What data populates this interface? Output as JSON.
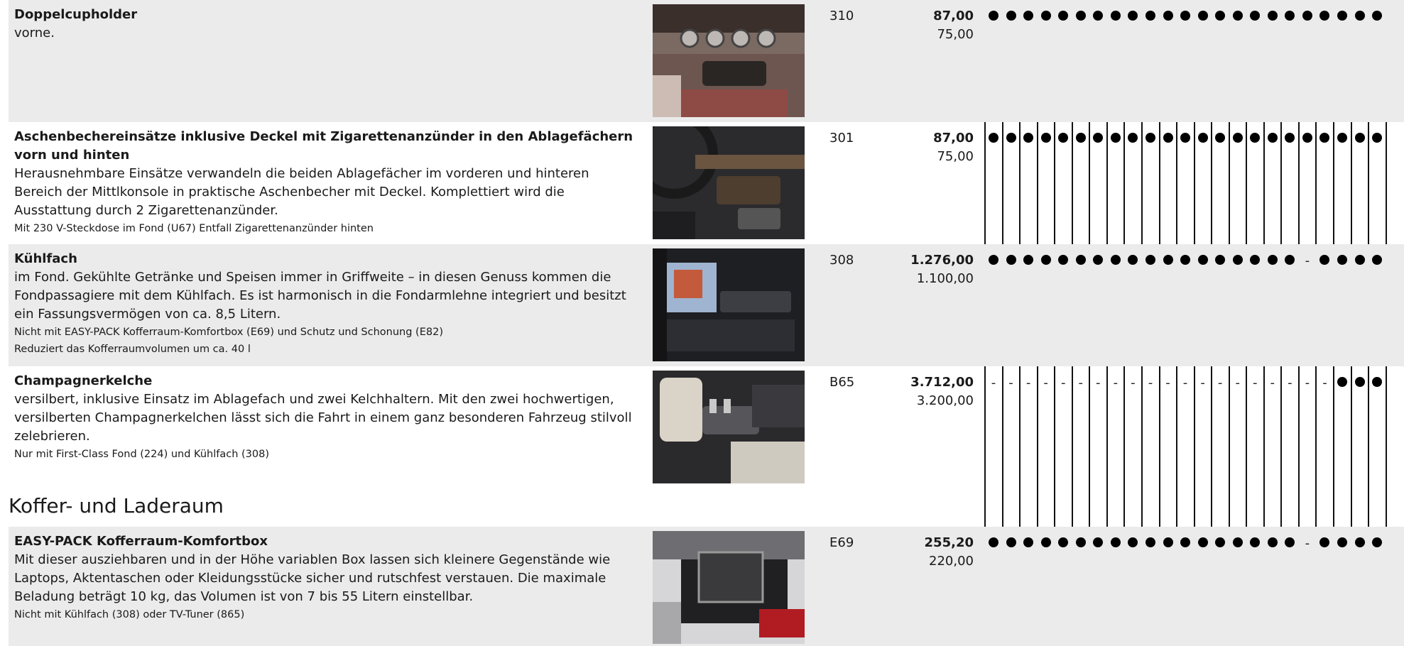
{
  "items": [
    {
      "title": "Doppelcupholder",
      "description": "vorne.",
      "notes": [],
      "code": "310",
      "price_gross": "87,00",
      "price_net": "75,00",
      "image": "car-interior-cupholder-photo",
      "marks": [
        "dot",
        "dot",
        "dot",
        "dot",
        "dot",
        "dot",
        "dot",
        "dot",
        "dot",
        "dot",
        "dot",
        "dot",
        "dot",
        "dot",
        "dot",
        "dot",
        "dot",
        "dot",
        "dot",
        "dot",
        "dot",
        "dot",
        "dot"
      ]
    },
    {
      "title": "Aschenbechereinsätze inklusive Deckel mit Zigarettenanzünder in den Ablagefächern vorn und hinten",
      "description": "Herausnehmbare Einsätze verwandeln die beiden Ablagefächer im vorderen und hinteren Bereich der Mittlkonsole in praktische Aschenbecher mit Deckel. Komplettiert wird die Ausstattung durch 2 Zigarettenanzünder.",
      "notes": [
        "Mit 230 V-Steckdose im Fond (U67) Entfall Zigarettenanzünder hinten"
      ],
      "code": "301",
      "price_gross": "87,00",
      "price_net": "75,00",
      "image": "car-center-console-photo",
      "marks": [
        "dot",
        "dot",
        "dot",
        "dot",
        "dot",
        "dot",
        "dot",
        "dot",
        "dot",
        "dot",
        "dot",
        "dot",
        "dot",
        "dot",
        "dot",
        "dot",
        "dot",
        "dot",
        "dot",
        "dot",
        "dot",
        "dot",
        "dot"
      ]
    },
    {
      "title": "Kühlfach",
      "description": "im Fond. Gekühlte Getränke und Speisen immer in Griffweite – in diesen Genuss kommen die Fondpassagiere mit dem Kühlfach. Es ist harmonisch in die Fondarmlehne integriert und besitzt ein Fassungsvermögen von ca. 8,5 Litern.",
      "notes": [
        "Nicht mit EASY-PACK Kofferraum-Komfortbox (E69) und Schutz und Schonung (E82)",
        "Reduziert das Kofferraumvolumen um ca. 40 l"
      ],
      "code": "308",
      "price_gross": "1.276,00",
      "price_net": "1.100,00",
      "image": "rear-cooling-box-photo",
      "marks": [
        "dot",
        "dot",
        "dot",
        "dot",
        "dot",
        "dot",
        "dot",
        "dot",
        "dot",
        "dot",
        "dot",
        "dot",
        "dot",
        "dot",
        "dot",
        "dot",
        "dot",
        "dot",
        "dash",
        "dot",
        "dot",
        "dot",
        "dot"
      ]
    },
    {
      "title": "Champagnerkelche",
      "description": "versilbert, inklusive Einsatz im Ablagefach und zwei Kelchhaltern. Mit den zwei hochwertigen, versilberten Champagnerkelchen lässt sich die Fahrt in einem ganz besonderen Fahrzeug stilvoll zelebrieren.",
      "notes": [
        "Nur mit First-Class Fond (224) und Kühlfach (308)"
      ],
      "code": "B65",
      "price_gross": "3.712,00",
      "price_net": "3.200,00",
      "image": "rear-seat-champagne-photo",
      "marks": [
        "dash",
        "dash",
        "dash",
        "dash",
        "dash",
        "dash",
        "dash",
        "dash",
        "dash",
        "dash",
        "dash",
        "dash",
        "dash",
        "dash",
        "dash",
        "dash",
        "dash",
        "dash",
        "dash",
        "dash",
        "dot",
        "dot",
        "dot"
      ]
    },
    {
      "title": "EASY-PACK Kofferraum-Komfortbox",
      "description": "Mit dieser ausziehbaren und in der Höhe variablen Box lassen sich kleinere Gegenstände wie Laptops, Aktentaschen oder Kleidungsstücke sicher und rutschfest verstauen. Die maximale Beladung beträgt 10 kg, das Volumen ist von 7 bis 55 Litern einstellbar.",
      "notes": [
        "Nicht mit Kühlfach (308) oder TV-Tuner (865)"
      ],
      "code": "E69",
      "price_gross": "255,20",
      "price_net": "220,00",
      "image": "trunk-comfort-box-photo",
      "marks": [
        "dot",
        "dot",
        "dot",
        "dot",
        "dot",
        "dot",
        "dot",
        "dot",
        "dot",
        "dot",
        "dot",
        "dot",
        "dot",
        "dot",
        "dot",
        "dot",
        "dot",
        "dot",
        "dash",
        "dot",
        "dot",
        "dot",
        "dot"
      ]
    }
  ],
  "section": {
    "title": "Koffer- und Laderaum"
  }
}
